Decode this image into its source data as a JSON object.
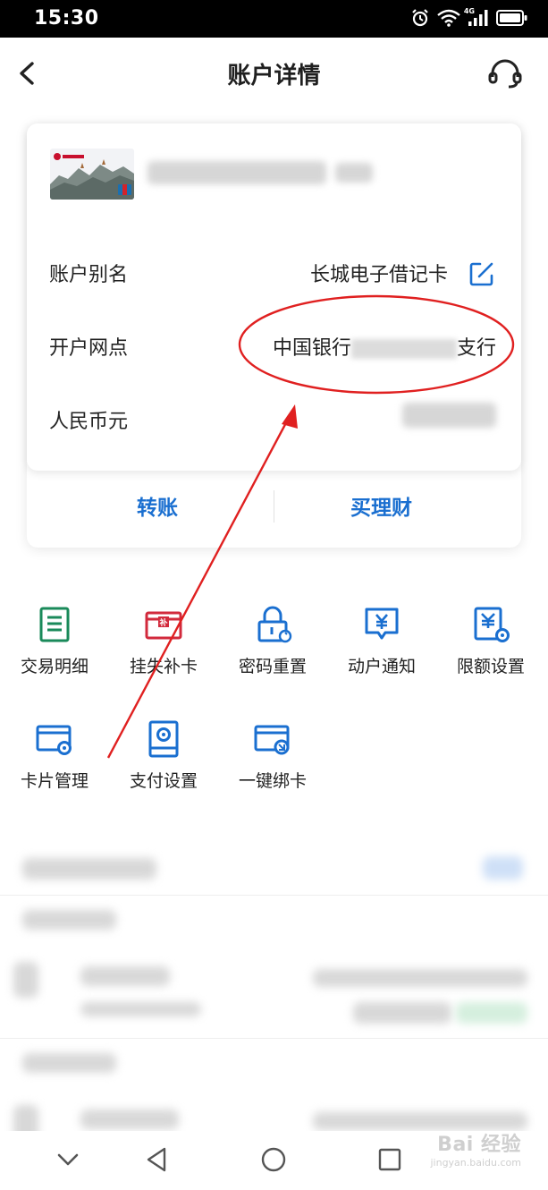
{
  "status_bar": {
    "time": "15:30",
    "network": "4G",
    "icons": [
      "alarm-icon",
      "wifi-icon",
      "signal-icon",
      "battery-icon"
    ]
  },
  "header": {
    "title": "账户详情",
    "back_icon": "back-icon",
    "service_icon": "headset-icon"
  },
  "account_card": {
    "rows": [
      {
        "label": "账户别名",
        "value": "长城电子借记卡"
      },
      {
        "label": "开户网点",
        "value_prefix": "中国银行",
        "value_suffix": "支行"
      },
      {
        "label": "人民币元"
      }
    ],
    "actions": [
      "转账",
      "买理财"
    ]
  },
  "functions": [
    {
      "label": "交易明细",
      "icon": "transaction-list-icon",
      "color": "#1a8a5a"
    },
    {
      "label": "挂失补卡",
      "icon": "report-loss-card-icon",
      "color": "#d22a3c"
    },
    {
      "label": "密码重置",
      "icon": "password-reset-lock-icon",
      "color": "#1a6fd0"
    },
    {
      "label": "动户通知",
      "icon": "yuan-notification-icon",
      "color": "#1a6fd0"
    },
    {
      "label": "限额设置",
      "icon": "limit-settings-icon",
      "color": "#1a6fd0"
    },
    {
      "label": "卡片管理",
      "icon": "card-manage-icon",
      "color": "#1a6fd0"
    },
    {
      "label": "支付设置",
      "icon": "payment-settings-icon",
      "color": "#1a6fd0"
    },
    {
      "label": "一键绑卡",
      "icon": "one-click-bind-icon",
      "color": "#1a6fd0"
    }
  ],
  "nav_bar": [
    "chevron-down-icon",
    "back-triangle-icon",
    "home-circle-icon",
    "recents-square-icon"
  ],
  "watermark": {
    "main": "Bai 经验",
    "sub": "jingyan.baidu.com"
  },
  "colors": {
    "accent": "#1a6fd0",
    "annotation": "#e02020"
  }
}
